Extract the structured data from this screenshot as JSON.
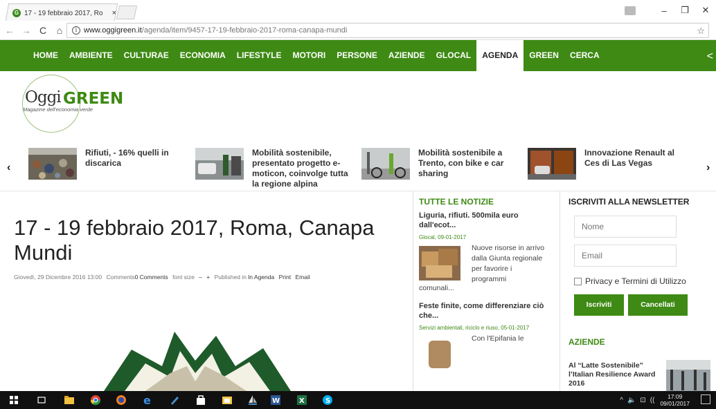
{
  "browser": {
    "tab_title": "17 - 19 febbraio 2017, Ro",
    "tab_close": "×",
    "url_host": "www.oggigreen.it",
    "url_path": "/agenda/item/9457-17-19-febbraio-2017-roma-canapa-mundi",
    "back_icon": "←",
    "forward_icon": "→",
    "reload_icon": "C",
    "home_icon": "⌂",
    "info_icon": "i",
    "star_icon": "☆",
    "minimize": "–",
    "restore": "❐",
    "close": "✕"
  },
  "nav": {
    "items": [
      "HOME",
      "AMBIENTE",
      "CULTURAE",
      "ECONOMIA",
      "LIFESTYLE",
      "MOTORI",
      "PERSONE",
      "AZIENDE",
      "GLOCAL",
      "AGENDA",
      "GREEN",
      "CERCA"
    ],
    "active": "AGENDA",
    "share_icon": "<",
    "color": "#3e8a14"
  },
  "logo": {
    "oggi": "Oggi",
    "green": "GREEN",
    "tagline": "Magazine dell'economia verde"
  },
  "carousel": {
    "prev": "‹",
    "next": "›",
    "items": [
      {
        "text": "Rifiuti, - 16% quelli in discarica",
        "icon": "landfill-photo"
      },
      {
        "text": "Mobilità sostenibile, presentato progetto e-moticon, coinvolge tutta la regione alpina",
        "icon": "charging-station-photo"
      },
      {
        "text": "Mobilità sostenibile a Trento, con bike e car sharing",
        "icon": "bike-sharing-photo"
      },
      {
        "text": "Innovazione Renault al Ces di Las Vegas",
        "icon": "renault-garage-photo"
      }
    ]
  },
  "article": {
    "title": "17 - 19 febbraio 2017, Roma, Canapa Mundi",
    "date": "Giovedì, 29 Dicembre 2016 13:00",
    "comments_label": "Comments",
    "comments_value": "0 Comments",
    "font_size_label": "font size",
    "font_minus": "–",
    "font_plus": "+",
    "published_label": "Published in",
    "published_value": "In Agenda",
    "print": "Print",
    "email": "Email"
  },
  "news": {
    "heading": "TUTTE LE NOTIZIE",
    "items": [
      {
        "title": "Liguria, rifiuti. 500mila euro dall'ecot...",
        "meta": "Glocal, 09-01-2017",
        "body": "Nuove risorse in arrivo dalla Giunta regionale per favorire i programmi",
        "more": "comunali..."
      },
      {
        "title": "Feste finite, come differenziare ciò che...",
        "meta": "Servizi ambientali, riciclo e riuso, 05-01-2017",
        "body": "Con l'Epifania le"
      }
    ]
  },
  "newsletter": {
    "heading": "ISCRIVITI ALLA NEWSLETTER",
    "name_placeholder": "Nome",
    "email_placeholder": "Email",
    "privacy": "Privacy e Termini di Utilizzo",
    "subscribe": "Iscriviti",
    "unsubscribe": "Cancellati"
  },
  "aziende": {
    "heading": "AZIENDE",
    "item": "Al “Latte Sostenibile” l’Italian Resilience Award 2016"
  },
  "taskbar": {
    "time": "17:09",
    "date": "09/01/2017",
    "tray": [
      "^",
      "🔈",
      "⊡",
      "((",
      "▤"
    ]
  }
}
